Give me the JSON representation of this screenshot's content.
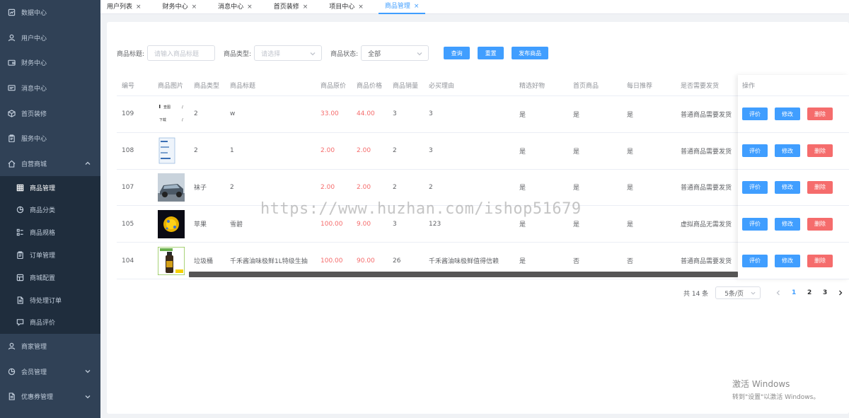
{
  "sidebar": {
    "items": [
      {
        "label": "数据中心",
        "icon": "chart-icon"
      },
      {
        "label": "用户中心",
        "icon": "user-icon"
      },
      {
        "label": "财务中心",
        "icon": "wallet-icon"
      },
      {
        "label": "消息中心",
        "icon": "message-icon"
      },
      {
        "label": "首页装修",
        "icon": "box-icon"
      },
      {
        "label": "服务中心",
        "icon": "clipboard-icon"
      },
      {
        "label": "自营商城",
        "icon": "home-icon",
        "expanded": true
      }
    ],
    "submenu": [
      {
        "label": "商品管理",
        "icon": "grid-icon",
        "active": true
      },
      {
        "label": "商品分类",
        "icon": "pie-icon"
      },
      {
        "label": "商品规格",
        "icon": "list-icon"
      },
      {
        "label": "订单管理",
        "icon": "clipboard-icon"
      },
      {
        "label": "商城配置",
        "icon": "layout-icon"
      },
      {
        "label": "待处理订单",
        "icon": "doc-icon"
      },
      {
        "label": "商品评价",
        "icon": "chat-icon"
      }
    ],
    "bottom_items": [
      {
        "label": "商家管理",
        "icon": "user-icon"
      },
      {
        "label": "会员管理",
        "icon": "pie-icon"
      },
      {
        "label": "优惠券管理",
        "icon": "doc-icon"
      }
    ]
  },
  "tabs": [
    {
      "label": "用户列表",
      "active": false
    },
    {
      "label": "财务中心",
      "active": false
    },
    {
      "label": "消息中心",
      "active": false
    },
    {
      "label": "首页装修",
      "active": false
    },
    {
      "label": "项目中心",
      "active": false
    },
    {
      "label": "商品管理",
      "active": true
    }
  ],
  "filter": {
    "title_label": "商品标题:",
    "title_placeholder": "请输入商品标题",
    "type_label": "商品类型:",
    "type_placeholder": "请选择",
    "status_label": "商品状态:",
    "status_value": "全部",
    "query_button": "查询",
    "reset_button": "重置",
    "publish_button": "发布商品"
  },
  "table": {
    "headers": [
      "编号",
      "商品图片",
      "商品类型",
      "商品标题",
      "商品原价",
      "商品价格",
      "商品销量",
      "必买理由",
      "精选好物",
      "首页商品",
      "每日推荐",
      "是否需要发货",
      "操作"
    ],
    "rows": [
      {
        "id": "109",
        "type": "2",
        "title": "w",
        "orig": "33.00",
        "price": "44.00",
        "sales": "3",
        "reason": "3",
        "featured": "是",
        "home": "是",
        "daily": "是",
        "ship": "普通商品需要发货"
      },
      {
        "id": "108",
        "type": "2",
        "title": "1",
        "orig": "2.00",
        "price": "2.00",
        "sales": "2",
        "reason": "3",
        "featured": "是",
        "home": "是",
        "daily": "是",
        "ship": "普通商品需要发货"
      },
      {
        "id": "107",
        "type": "袜子",
        "title": "2",
        "orig": "2.00",
        "price": "2.00",
        "sales": "2",
        "reason": "2",
        "featured": "是",
        "home": "是",
        "daily": "是",
        "ship": "普通商品需要发货"
      },
      {
        "id": "105",
        "type": "苹果",
        "title": "雪碧",
        "orig": "100.00",
        "price": "9.00",
        "sales": "3",
        "reason": "123",
        "featured": "是",
        "home": "是",
        "daily": "是",
        "ship": "虚拟商品无需发货"
      },
      {
        "id": "104",
        "type": "垃圾桶",
        "title": "千禾酱油味极鲜1L特级生抽",
        "orig": "100.00",
        "price": "90.00",
        "sales": "26",
        "reason": "千禾酱油味极鲜值得信赖",
        "featured": "是",
        "home": "否",
        "daily": "否",
        "ship": "普通商品需要发货"
      }
    ],
    "actions": {
      "review": "评价",
      "edit": "修改",
      "delete": "删除"
    }
  },
  "thumb1_text": {
    "top": "查图",
    "bottom": "下载"
  },
  "pagination": {
    "total": "共 14 条",
    "page_size": "5条/页",
    "pages": [
      "1",
      "2",
      "3"
    ],
    "current": "1"
  },
  "watermark": "https://www.huzhan.com/ishop51679",
  "windows_activation": {
    "title": "激活 Windows",
    "subtitle": "转到\"设置\"以激活 Windows。"
  },
  "colors": {
    "sidebar_bg": "#304156",
    "submenu_bg": "#1f2d3d",
    "primary": "#409eff",
    "danger": "#f56c6c"
  }
}
